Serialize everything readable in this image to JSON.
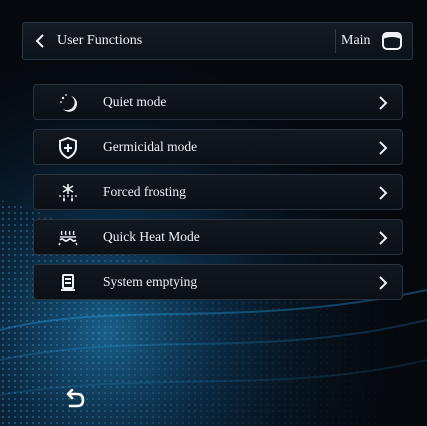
{
  "header": {
    "back_icon": "chevron-left-icon",
    "title": "User Functions",
    "main_label": "Main",
    "home_icon": "home-display-icon"
  },
  "menu": [
    {
      "label": "Quiet mode",
      "icon": "moon-stars-icon"
    },
    {
      "label": "Germicidal mode",
      "icon": "shield-plus-icon"
    },
    {
      "label": "Forced frosting",
      "icon": "snowflake-drops-icon"
    },
    {
      "label": "Quick Heat Mode",
      "icon": "heat-coil-icon"
    },
    {
      "label": "System emptying",
      "icon": "tank-drain-icon"
    }
  ],
  "footer": {
    "return_icon": "return-arrow-icon"
  },
  "colors": {
    "background": "#05080d",
    "row_border": "#28333f",
    "text": "#eef2f6",
    "accent_glow": "#1f8fd6"
  }
}
